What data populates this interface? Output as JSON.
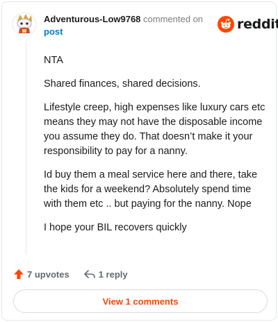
{
  "comment": {
    "username": "Adventurous-Low9768",
    "action_text": "commented on",
    "post_link": "post",
    "avatar_icon": "snoo-avatar-icon",
    "paragraphs": [
      "NTA",
      "Shared finances, shared decisions.",
      "Lifestyle creep, high expenses like luxury cars etc means they may not have the disposable income you assume they do. That doesn’t make it your responsibility to pay for a nanny.",
      "Id buy them a meal service here and there, take the kids for a weekend? Absolutely spend time with them etc .. but paying for the nanny. Nope",
      "I hope your BIL recovers quickly"
    ]
  },
  "brand": {
    "logo_text": "reddit",
    "logo_icon": "reddit-snoo-icon",
    "accent": "#ff4500"
  },
  "actions": {
    "upvotes": "7 upvotes",
    "upvote_icon": "upvote-arrow-icon",
    "reply": "1 reply",
    "reply_icon": "reply-arrow-icon"
  },
  "footer": {
    "view_comments": "View 1 comments"
  }
}
